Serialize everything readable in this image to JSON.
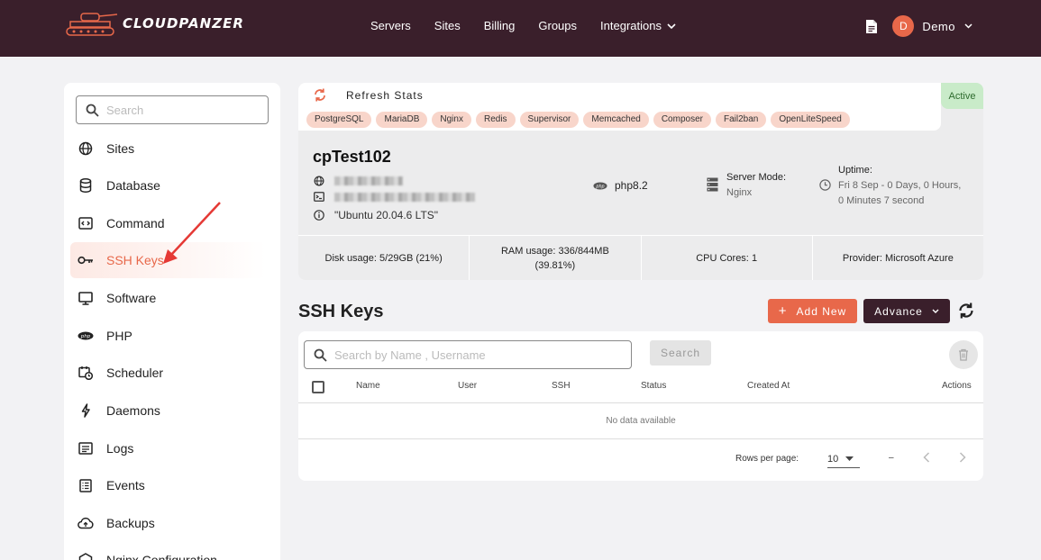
{
  "brand": {
    "name": "CLOUDPANZER"
  },
  "nav": [
    {
      "label": "Servers"
    },
    {
      "label": "Sites"
    },
    {
      "label": "Billing"
    },
    {
      "label": "Groups"
    },
    {
      "label": "Integrations"
    }
  ],
  "user": {
    "initial": "D",
    "name": "Demo"
  },
  "sidebar": {
    "search_placeholder": "Search",
    "items": [
      {
        "label": "Sites",
        "icon": "globe-icon"
      },
      {
        "label": "Database",
        "icon": "database-icon"
      },
      {
        "label": "Command",
        "icon": "code-icon"
      },
      {
        "label": "SSH Keys",
        "icon": "key-icon",
        "active": true
      },
      {
        "label": "Software",
        "icon": "monitor-icon"
      },
      {
        "label": "PHP",
        "icon": "php-icon"
      },
      {
        "label": "Scheduler",
        "icon": "calendar-clock-icon"
      },
      {
        "label": "Daemons",
        "icon": "bolt-icon"
      },
      {
        "label": "Logs",
        "icon": "log-icon"
      },
      {
        "label": "Events",
        "icon": "list-icon"
      },
      {
        "label": "Backups",
        "icon": "cloud-upload-icon"
      },
      {
        "label": "Nginx Configuration",
        "icon": "nginx-icon"
      }
    ]
  },
  "server": {
    "refresh_label": "Refresh Stats",
    "tags": [
      "PostgreSQL",
      "MariaDB",
      "Nginx",
      "Redis",
      "Supervisor",
      "Memcached",
      "Composer",
      "Fail2ban",
      "OpenLiteSpeed"
    ],
    "status": "Active",
    "name": "cpTest102",
    "os": "\"Ubuntu 20.04.6 LTS\"",
    "php": "php8.2",
    "server_mode_label": "Server Mode:",
    "server_mode": "Nginx",
    "uptime_label": "Uptime:",
    "uptime_line1": "Fri 8 Sep - 0 Days, 0 Hours,",
    "uptime_line2": "0 Minutes 7 second",
    "disk_label": "Disk usage:",
    "disk_value": "5/29GB (21%)",
    "ram_label": "RAM usage:",
    "ram_value": "336/844MB",
    "ram_pct": "(39.81%)",
    "cpu_label": "CPU Cores:",
    "cpu_value": "1",
    "provider_label": "Provider:",
    "provider_value": "Microsoft Azure"
  },
  "ssh": {
    "title": "SSH Keys",
    "add_label": "Add New",
    "advance_label": "Advance",
    "search_placeholder": "Search by Name , Username",
    "search_btn": "Search",
    "columns": [
      "Name",
      "User",
      "SSH",
      "Status",
      "Created At",
      "Actions"
    ],
    "empty_text": "No data available",
    "rows_per_page_label": "Rows per page:",
    "rows_per_page": "10",
    "page_info": "–"
  },
  "colors": {
    "brand_dark": "#3a1f2b",
    "accent": "#e8684a",
    "active_green": "#c9ebc9"
  }
}
